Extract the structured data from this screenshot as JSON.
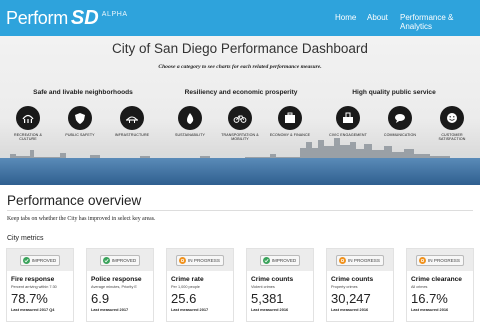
{
  "nav": {
    "brand_word": "Perform",
    "brand_sd": "SD",
    "brand_tag": "ALPHA",
    "items": [
      {
        "label": "Home"
      },
      {
        "label": "About"
      },
      {
        "label": "Performance & Analytics"
      }
    ]
  },
  "hero": {
    "title": "City of San Diego Performance Dashboard",
    "subtitle": "Choose a category to see charts for each related performance measure.",
    "groups": [
      {
        "title": "Safe and livable neighborhoods"
      },
      {
        "title": "Resiliency and economic prosperity"
      },
      {
        "title": "High quality public service"
      }
    ],
    "categories": [
      {
        "label": "RECREATION & CULTURE",
        "icon": "recreation-icon"
      },
      {
        "label": "PUBLIC SAFETY",
        "icon": "public-safety-icon"
      },
      {
        "label": "INFRASTRUCTURE",
        "icon": "infrastructure-icon"
      },
      {
        "label": "SUSTAINABILITY",
        "icon": "sustainability-icon"
      },
      {
        "label": "TRANSPORTATION & MOBILITY",
        "icon": "bicycle-icon"
      },
      {
        "label": "ECONOMY & FINANCE",
        "icon": "economy-icon"
      },
      {
        "label": "CIVIC ENGAGEMENT",
        "icon": "civic-engagement-icon"
      },
      {
        "label": "COMMUNICATION",
        "icon": "communication-icon"
      },
      {
        "label": "CUSTOMER SATISFACTION",
        "icon": "customer-satisfaction-icon"
      }
    ]
  },
  "overview": {
    "title": "Performance overview",
    "description": "Keep tabs on whether the City has improved in select key areas.",
    "metrics_label": "City metrics"
  },
  "status_colors": {
    "improved": "#3aa35b",
    "in_progress": "#f0921e"
  },
  "metrics": [
    {
      "status": "IMPROVED",
      "title": "Fire response",
      "sub": "Percent arriving within 7:30",
      "value": "78.7%",
      "foot": "Last measured 2017 Q4"
    },
    {
      "status": "IMPROVED",
      "title": "Police response",
      "sub": "Average minutes, Priority E",
      "value": "6.9",
      "foot": "Last measured 2017"
    },
    {
      "status": "IN PROGRESS",
      "title": "Crime rate",
      "sub": "Per 1,000 people",
      "value": "25.6",
      "foot": "Last measured 2017"
    },
    {
      "status": "IMPROVED",
      "title": "Crime counts",
      "sub": "Violent crimes",
      "value": "5,381",
      "foot": "Last measured 2016"
    },
    {
      "status": "IN PROGRESS",
      "title": "Crime counts",
      "sub": "Property crimes",
      "value": "30,247",
      "foot": "Last measured 2016"
    },
    {
      "status": "IN PROGRESS",
      "title": "Crime clearance",
      "sub": "All crimes",
      "value": "16.7%",
      "foot": "Last measured 2016"
    }
  ]
}
